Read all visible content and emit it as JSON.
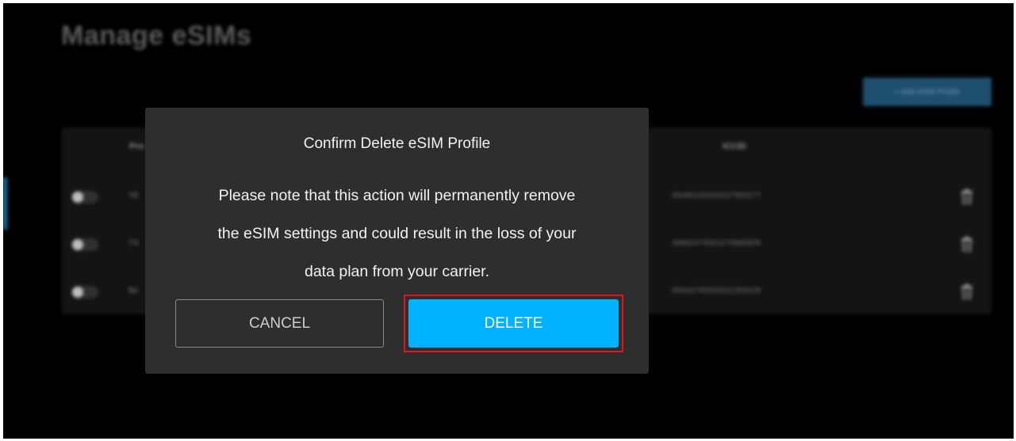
{
  "page": {
    "title": "Manage eSIMs",
    "add_button_label": "+ Add eSIM Profile"
  },
  "table": {
    "headers": {
      "profile": "Pro",
      "iccid": "ICCID"
    },
    "rows": [
      {
        "name": "YE",
        "iccid": "89480100000027992577"
      },
      {
        "name": "TS",
        "iccid": "89882470001275886809"
      },
      {
        "name": "Be",
        "iccid": "89444765000022263429"
      }
    ]
  },
  "dialog": {
    "title": "Confirm Delete eSIM Profile",
    "message_lines": [
      "Please note that this action will permanently remove",
      "the eSIM settings and could result in the loss of your",
      "data plan from your carrier."
    ],
    "cancel_label": "CANCEL",
    "delete_label": "DELETE"
  },
  "colors": {
    "accent": "#00b2ff",
    "highlight": "#e1171b",
    "dialog_bg": "#2e2e2e",
    "screen_bg": "#000000"
  },
  "icons": [
    "trash-icon",
    "toggle-switch"
  ]
}
